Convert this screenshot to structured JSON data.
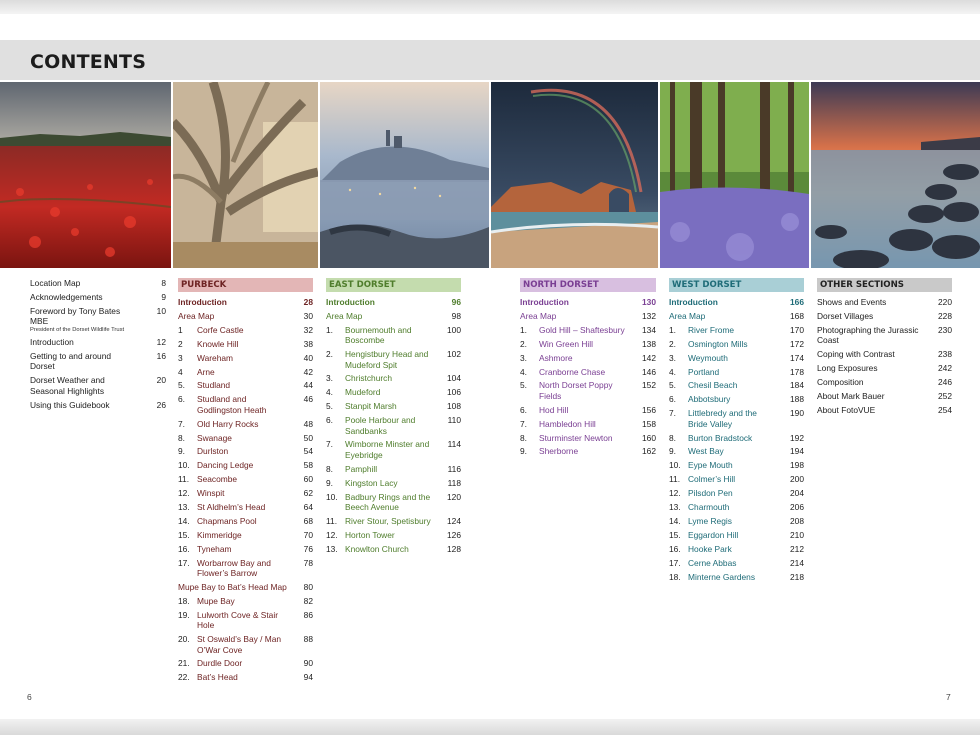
{
  "title": "CONTENTS",
  "folio_left": "6",
  "folio_right": "7",
  "colors": {
    "purbeck_bar": "#e3b6b6",
    "purbeck_text": "#6e2424",
    "east_bar": "#c4dcae",
    "east_text": "#4f7d2c",
    "north_bar": "#d8bfe0",
    "north_text": "#7a3f93",
    "west_bar": "#a9cfd6",
    "west_text": "#1f6c78",
    "other_bar": "#c9c9c9",
    "other_text": "#222222"
  },
  "front_matter": [
    {
      "label": "Location Map",
      "page": "8"
    },
    {
      "label": "Acknowledgements",
      "page": "9"
    },
    {
      "label": "Foreword by Tony Bates MBE",
      "sub": "President of the Dorset Wildlife Trust",
      "page": "10"
    },
    {
      "label": "Introduction",
      "page": "12"
    },
    {
      "label": "Getting to and around Dorset",
      "page": "16"
    },
    {
      "label": "Dorset Weather and Seasonal Highlights",
      "page": "20"
    },
    {
      "label": "Using this Guidebook",
      "page": "26"
    }
  ],
  "purbeck": {
    "heading": "PURBECK",
    "intro": {
      "label": "Introduction",
      "page": "28"
    },
    "area_map": {
      "label": "Area Map",
      "page": "30"
    },
    "items": [
      {
        "num": "1",
        "label": "Corfe Castle",
        "page": "32"
      },
      {
        "num": "2",
        "label": "Knowle Hill",
        "page": "38"
      },
      {
        "num": "3",
        "label": "Wareham",
        "page": "40"
      },
      {
        "num": "4",
        "label": "Arne",
        "page": "42"
      },
      {
        "num": "5.",
        "label": "Studland",
        "page": "44"
      },
      {
        "num": "6.",
        "label": "Studland and Godlingston Heath",
        "page": "46"
      },
      {
        "num": "7.",
        "label": "Old Harry Rocks",
        "page": "48"
      },
      {
        "num": "8.",
        "label": "Swanage",
        "page": "50"
      },
      {
        "num": "9.",
        "label": "Durlston",
        "page": "54"
      },
      {
        "num": "10.",
        "label": "Dancing Ledge",
        "page": "58"
      },
      {
        "num": "11.",
        "label": "Seacombe",
        "page": "60"
      },
      {
        "num": "12.",
        "label": "Winspit",
        "page": "62"
      },
      {
        "num": "13.",
        "label": "St Aldhelm’s Head",
        "page": "64"
      },
      {
        "num": "14.",
        "label": "Chapmans Pool",
        "page": "68"
      },
      {
        "num": "15.",
        "label": "Kimmeridge",
        "page": "70"
      },
      {
        "num": "16.",
        "label": "Tyneham",
        "page": "76"
      },
      {
        "num": "17.",
        "label": "Worbarrow Bay and Flower’s Barrow",
        "page": "78"
      }
    ],
    "mupe_map": {
      "label": "Mupe Bay to Bat’s Head Map",
      "page": "80"
    },
    "items2": [
      {
        "num": "18.",
        "label": "Mupe Bay",
        "page": "82"
      },
      {
        "num": "19.",
        "label": "Lulworth Cove & Stair Hole",
        "page": "86"
      },
      {
        "num": "20.",
        "label": "St Oswald’s Bay / Man O’War Cove",
        "page": "88"
      },
      {
        "num": "21.",
        "label": "Durdle Door",
        "page": "90"
      },
      {
        "num": "22.",
        "label": "Bat’s Head",
        "page": "94"
      }
    ]
  },
  "east_dorset": {
    "heading": "EAST DORSET",
    "intro": {
      "label": "Introduction",
      "page": "96"
    },
    "area_map": {
      "label": "Area Map",
      "page": "98"
    },
    "items": [
      {
        "num": "1.",
        "label": "Bournemouth and Boscombe",
        "page": "100"
      },
      {
        "num": "2.",
        "label": "Hengistbury Head and Mudeford Spit",
        "page": "102"
      },
      {
        "num": "3.",
        "label": "Christchurch",
        "page": "104"
      },
      {
        "num": "4.",
        "label": "Mudeford",
        "page": "106"
      },
      {
        "num": "5.",
        "label": "Stanpit Marsh",
        "page": "108"
      },
      {
        "num": "6.",
        "label": "Poole Harbour and Sandbanks",
        "page": "110"
      },
      {
        "num": "7.",
        "label": "Wimborne Minster and Eyebridge",
        "page": "114"
      },
      {
        "num": "8.",
        "label": "Pamphill",
        "page": "116"
      },
      {
        "num": "9.",
        "label": "Kingston Lacy",
        "page": "118"
      },
      {
        "num": "10.",
        "label": "Badbury Rings and the Beech Avenue",
        "page": "120"
      },
      {
        "num": "11.",
        "label": "River Stour, Spetisbury",
        "page": "124"
      },
      {
        "num": "12.",
        "label": "Horton Tower",
        "page": "126"
      },
      {
        "num": "13.",
        "label": "Knowlton Church",
        "page": "128"
      }
    ]
  },
  "north_dorset": {
    "heading": "NORTH DORSET",
    "intro": {
      "label": "Introduction",
      "page": "130"
    },
    "area_map": {
      "label": "Area Map",
      "page": "132"
    },
    "items": [
      {
        "num": "1.",
        "label": "Gold Hill – Shaftesbury",
        "page": "134"
      },
      {
        "num": "2.",
        "label": "Win Green Hill",
        "page": "138"
      },
      {
        "num": "3.",
        "label": "Ashmore",
        "page": "142"
      },
      {
        "num": "4.",
        "label": "Cranborne Chase",
        "page": "146"
      },
      {
        "num": "5.",
        "label": "North Dorset Poppy Fields",
        "page": "152"
      },
      {
        "num": "6.",
        "label": "Hod Hill",
        "page": "156"
      },
      {
        "num": "7.",
        "label": "Hambledon Hill",
        "page": "158"
      },
      {
        "num": "8.",
        "label": "Sturminster Newton",
        "page": "160"
      },
      {
        "num": "9.",
        "label": "Sherborne",
        "page": "162"
      }
    ]
  },
  "west_dorset": {
    "heading": "WEST DORSET",
    "intro": {
      "label": "Introduction",
      "page": "166"
    },
    "area_map": {
      "label": "Area Map",
      "page": "168"
    },
    "items": [
      {
        "num": "1.",
        "label": "River Frome",
        "page": "170"
      },
      {
        "num": "2.",
        "label": "Osmington Mills",
        "page": "172"
      },
      {
        "num": "3.",
        "label": "Weymouth",
        "page": "174"
      },
      {
        "num": "4.",
        "label": "Portland",
        "page": "178"
      },
      {
        "num": "5.",
        "label": "Chesil Beach",
        "page": "184"
      },
      {
        "num": "6.",
        "label": "Abbotsbury",
        "page": "188"
      },
      {
        "num": "7.",
        "label": "Littlebredy and the Bride Valley",
        "page": "190"
      },
      {
        "num": "8.",
        "label": "Burton Bradstock",
        "page": "192"
      },
      {
        "num": "9.",
        "label": "West Bay",
        "page": "194"
      },
      {
        "num": "10.",
        "label": "Eype Mouth",
        "page": "198"
      },
      {
        "num": "11.",
        "label": "Colmer’s Hill",
        "page": "200"
      },
      {
        "num": "12.",
        "label": "Pilsdon Pen",
        "page": "204"
      },
      {
        "num": "13.",
        "label": "Charmouth",
        "page": "206"
      },
      {
        "num": "14.",
        "label": "Lyme Regis",
        "page": "208"
      },
      {
        "num": "15.",
        "label": "Eggardon Hill",
        "page": "210"
      },
      {
        "num": "16.",
        "label": "Hooke Park",
        "page": "212"
      },
      {
        "num": "17.",
        "label": "Cerne Abbas",
        "page": "214"
      },
      {
        "num": "18.",
        "label": "Minterne Gardens",
        "page": "218"
      }
    ]
  },
  "other_sections": {
    "heading": "OTHER SECTIONS",
    "items": [
      {
        "label": "Shows and Events",
        "page": "220"
      },
      {
        "label": "Dorset Villages",
        "page": "228"
      },
      {
        "label": "Photographing the Jurassic Coast",
        "page": "230"
      },
      {
        "label": "Coping with Contrast",
        "page": "238"
      },
      {
        "label": "Long Exposures",
        "page": "242"
      },
      {
        "label": "Composition",
        "page": "246"
      },
      {
        "label": "About Mark Bauer",
        "page": "252"
      },
      {
        "label": "About FotoVUE",
        "page": "254"
      }
    ]
  }
}
